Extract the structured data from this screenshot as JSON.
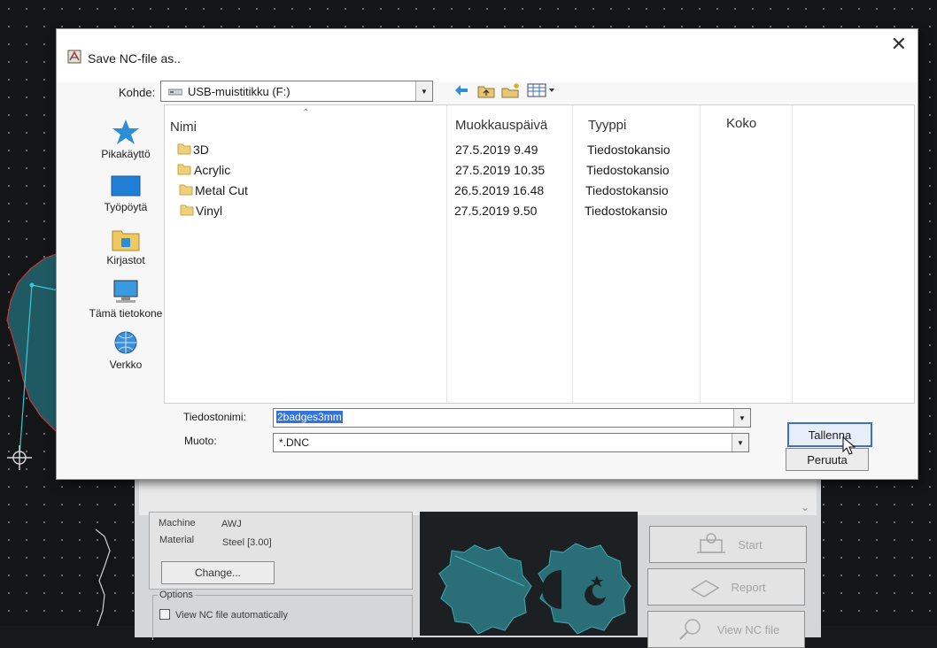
{
  "dialog": {
    "title": "Save NC-file as..",
    "look_in_label": "Kohde:",
    "look_in_value": "USB-muistitikku (F:)",
    "places": [
      {
        "label": "Pikakäyttö",
        "icon": "star-icon"
      },
      {
        "label": "Työpöytä",
        "icon": "desktop-icon"
      },
      {
        "label": "Kirjastot",
        "icon": "libraries-icon"
      },
      {
        "label": "Tämä tietokone",
        "icon": "computer-icon"
      },
      {
        "label": "Verkko",
        "icon": "network-icon"
      }
    ],
    "columns": {
      "name": "Nimi",
      "modified": "Muokkauspäivä",
      "type": "Tyyppi",
      "size": "Koko"
    },
    "files": [
      {
        "name": "3D",
        "modified": "27.5.2019 9.49",
        "type": "Tiedostokansio",
        "size": ""
      },
      {
        "name": "Acrylic",
        "modified": "27.5.2019 10.35",
        "type": "Tiedostokansio",
        "size": ""
      },
      {
        "name": "Metal Cut",
        "modified": "26.5.2019 16.48",
        "type": "Tiedostokansio",
        "size": ""
      },
      {
        "name": "Vinyl",
        "modified": "27.5.2019 9.50",
        "type": "Tiedostokansio",
        "size": ""
      }
    ],
    "filename_label": "Tiedostonimi:",
    "filename_value": "2badges3mm",
    "filetype_label": "Muoto:",
    "filetype_value": "*.DNC",
    "save_button": "Tallenna",
    "cancel_button": "Peruuta",
    "close_icon": "close-icon"
  },
  "background_app": {
    "machine_label": "Machine",
    "machine_value": "AWJ",
    "material_label": "Material",
    "material_value": "Steel [3.00]",
    "change_button": "Change...",
    "options_title": "Options",
    "view_nc_label": "View NC file automatically",
    "view_nc_checked": false,
    "start_button": "Start",
    "report_button": "Report",
    "view_nc_button": "View NC file"
  },
  "colors": {
    "cad_background": "#131517",
    "part_fill": "#1f5a63",
    "part_outline": "#c0393b",
    "highlight_line": "#39c8d8",
    "selection": "#3372d6"
  }
}
